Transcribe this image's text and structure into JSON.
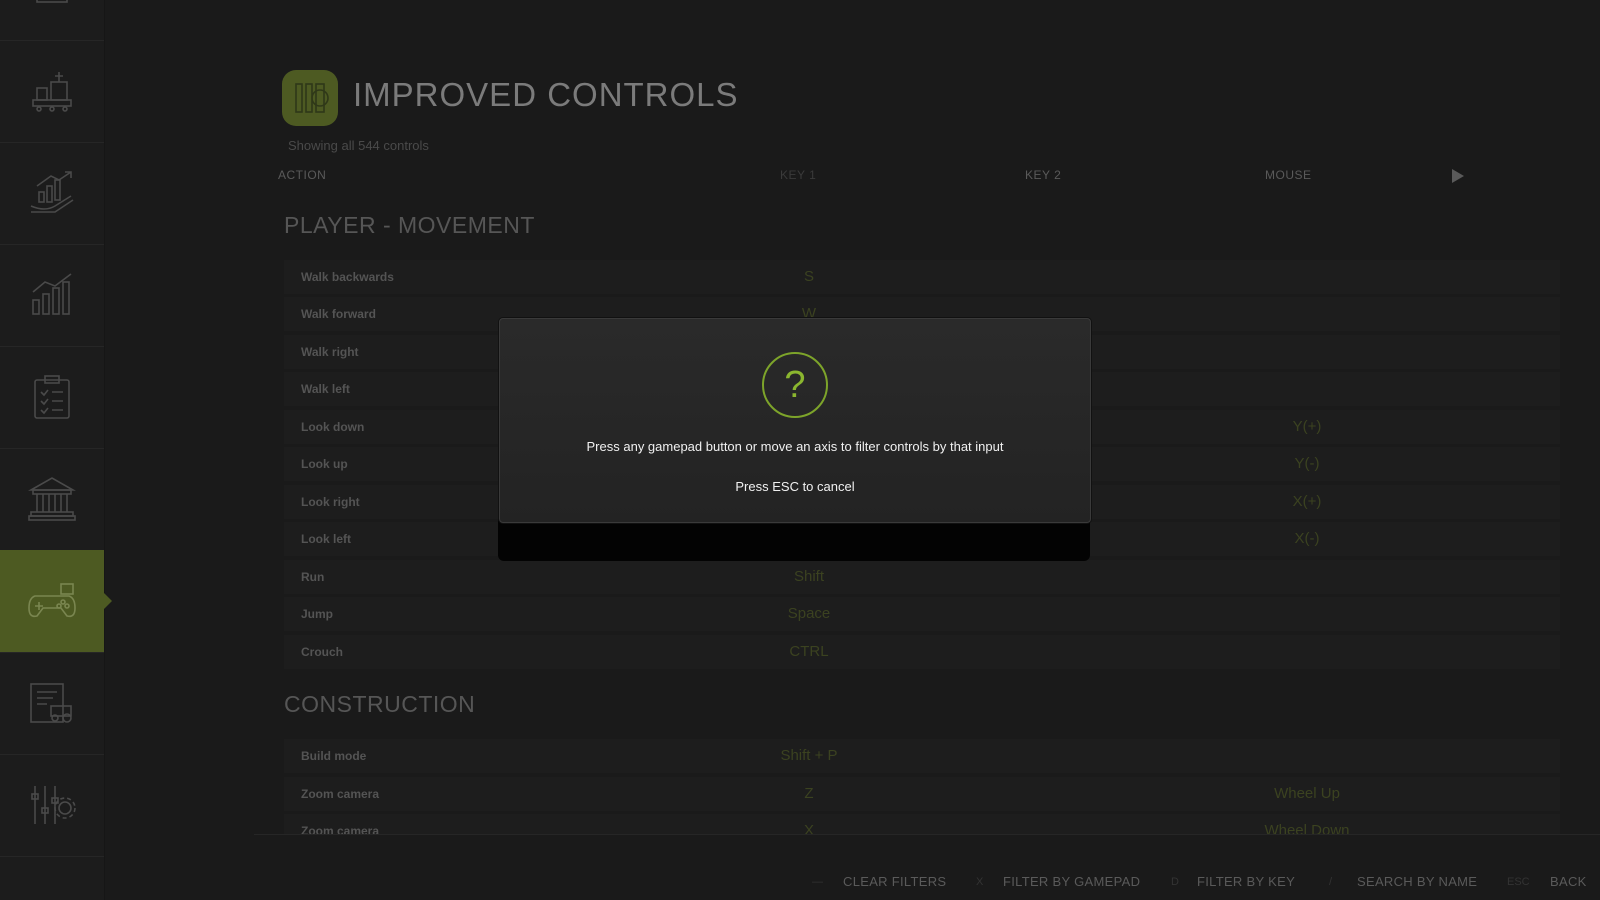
{
  "sidebar": {
    "items": [
      {
        "icon": "map-icon",
        "active": false
      },
      {
        "icon": "production-icon",
        "active": false
      },
      {
        "icon": "finance-growth-icon",
        "active": false
      },
      {
        "icon": "statistics-icon",
        "active": false
      },
      {
        "icon": "tasks-clipboard-icon",
        "active": false
      },
      {
        "icon": "bank-icon",
        "active": false
      },
      {
        "icon": "gamepad-icon",
        "active": true
      },
      {
        "icon": "vehicle-list-icon",
        "active": false
      },
      {
        "icon": "settings-sliders-icon",
        "active": false
      }
    ]
  },
  "header": {
    "title": "IMPROVED CONTROLS",
    "subtitle": "Showing all 544 controls"
  },
  "columns": {
    "action": "ACTION",
    "key1": "KEY 1",
    "key2": "KEY 2",
    "mouse": "MOUSE"
  },
  "sections": [
    {
      "title": "PLAYER - MOVEMENT",
      "rows": [
        {
          "action": "Walk backwards",
          "key1": "S",
          "mouse": ""
        },
        {
          "action": "Walk forward",
          "key1": "W",
          "mouse": ""
        },
        {
          "action": "Walk right",
          "key1": "",
          "mouse": ""
        },
        {
          "action": "Walk left",
          "key1": "",
          "mouse": ""
        },
        {
          "action": "Look down",
          "key1": "",
          "mouse": "Y(+)"
        },
        {
          "action": "Look up",
          "key1": "",
          "mouse": "Y(-)"
        },
        {
          "action": "Look right",
          "key1": "",
          "mouse": "X(+)"
        },
        {
          "action": "Look left",
          "key1": "",
          "mouse": "X(-)"
        },
        {
          "action": "Run",
          "key1": "Shift",
          "mouse": ""
        },
        {
          "action": "Jump",
          "key1": "Space",
          "mouse": ""
        },
        {
          "action": "Crouch",
          "key1": "CTRL",
          "mouse": ""
        }
      ]
    },
    {
      "title": "CONSTRUCTION",
      "rows": [
        {
          "action": "Build mode",
          "key1": "Shift + P",
          "mouse": ""
        },
        {
          "action": "Zoom camera",
          "key1": "Z",
          "mouse": "Wheel Up"
        },
        {
          "action": "Zoom camera",
          "key1": "X",
          "mouse": "Wheel Down"
        }
      ]
    }
  ],
  "footer": {
    "clear_key": "—",
    "clear_label": "CLEAR FILTERS",
    "gamepad_key": "X",
    "gamepad_label": "FILTER BY GAMEPAD",
    "key_key": "D",
    "key_label": "FILTER BY KEY",
    "search_key": "/",
    "search_label": "SEARCH BY NAME",
    "back_key": "ESC",
    "back_label": "BACK"
  },
  "modal": {
    "icon": "?",
    "message": "Press any gamepad button or move an axis to filter controls by that input",
    "cancel": "Press ESC to cancel"
  },
  "colors": {
    "accent": "#7da42a",
    "active_sidebar": "#4d5a22",
    "background": "#1a1a1a"
  }
}
